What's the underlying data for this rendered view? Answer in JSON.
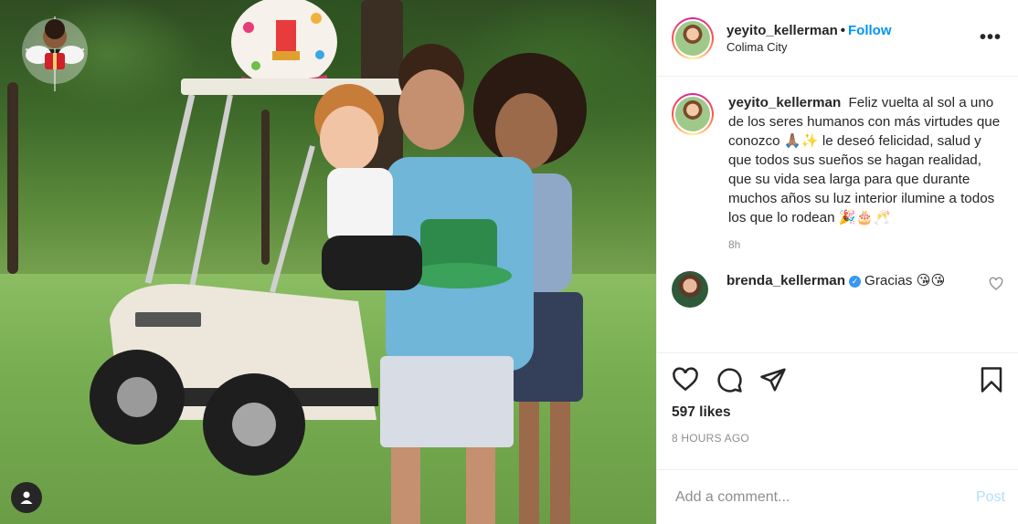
{
  "post": {
    "username": "yeyito_kellerman",
    "follow_label": "Follow",
    "separator": "•",
    "location": "Colima City",
    "more_label": "•••"
  },
  "caption": {
    "username": "yeyito_kellerman",
    "text": "Feliz vuelta al sol a uno de los seres humanos con más virtudes que conozco 🙏🏽✨ le deseó felicidad, salud y que todos sus sueños se hagan realidad, que su vida sea larga para que durante muchos años su luz interior ilumine a todos los que lo rodean 🎉🎂🥂",
    "time": "8h"
  },
  "comment": {
    "username": "brenda_kellerman",
    "verified_mark": "✓",
    "text": "Gracias 😘😘"
  },
  "stats": {
    "likes": "597 likes",
    "time_ago": "8 HOURS AGO"
  },
  "composer": {
    "placeholder": "Add a comment...",
    "post_label": "Post"
  },
  "colors": {
    "accent": "#0095f6",
    "post_disabled": "#b2dffc",
    "muted": "#8e8e8e"
  },
  "icons": [
    "like-icon",
    "comment-icon",
    "share-icon",
    "bookmark-icon",
    "more-icon",
    "user-tag-icon",
    "comment-like-icon"
  ]
}
